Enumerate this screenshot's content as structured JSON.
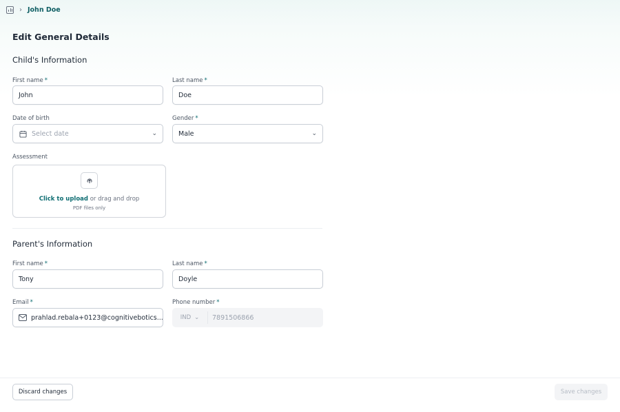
{
  "breadcrumb": {
    "current": "John Doe",
    "separator": "›"
  },
  "page_title": "Edit General Details",
  "child_section": {
    "title": "Child's Information",
    "first_name_label": "First name",
    "first_name_value": "John",
    "last_name_label": "Last name",
    "last_name_value": "Doe",
    "dob_label": "Date of birth",
    "dob_placeholder": "Select date",
    "gender_label": "Gender",
    "gender_value": "Male",
    "assessment_label": "Assessment",
    "upload_link": "Click to upload",
    "upload_rest": " or drag and drop",
    "upload_note": "PDF files only"
  },
  "parent_section": {
    "title": "Parent's Information",
    "first_name_label": "First name",
    "first_name_value": "Tony",
    "last_name_label": "Last name",
    "last_name_value": "Doyle",
    "email_label": "Email",
    "email_value": "prahlad.rebala+0123@cognitivebotics...",
    "phone_label": "Phone number",
    "phone_country": "IND",
    "phone_value": "7891506866"
  },
  "required_mark": "*",
  "footer": {
    "discard_label": "Discard changes",
    "save_label": "Save changes"
  },
  "colors": {
    "accent": "#0e6d72",
    "border": "#c8ced6",
    "disabled_bg": "#f3f4f6"
  },
  "icons": {
    "breadcrumb": "chart-bar-icon",
    "calendar": "calendar-icon",
    "upload": "upload-cloud-icon",
    "email": "mail-icon",
    "chevron": "chevron-down-icon"
  }
}
